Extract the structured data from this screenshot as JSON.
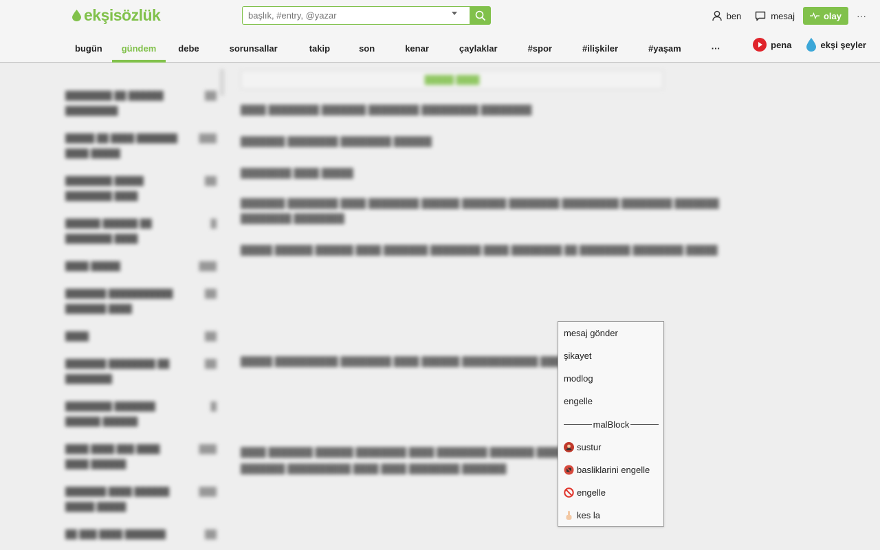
{
  "header": {
    "logo_text": "ekşisözlük",
    "search_placeholder": "başlık, #entry, @yazar",
    "user_label": "ben",
    "message_label": "mesaj",
    "olay_label": "olay",
    "more_label": "···"
  },
  "nav": {
    "tabs": [
      {
        "label": "bugün"
      },
      {
        "label": "gündem"
      },
      {
        "label": "debe"
      },
      {
        "label": "sorunsallar"
      },
      {
        "label": "takip"
      },
      {
        "label": "son"
      },
      {
        "label": "kenar"
      },
      {
        "label": "çaylaklar"
      },
      {
        "label": "#spor"
      },
      {
        "label": "#ilişkiler"
      },
      {
        "label": "#yaşam"
      },
      {
        "label": "···"
      }
    ],
    "active_tab": "gündem",
    "pena_label": "pena",
    "eksi_seyler_label": "ekşi şeyler"
  },
  "menu": {
    "items": [
      {
        "label": "mesaj gönder"
      },
      {
        "label": "şikayet"
      },
      {
        "label": "modlog"
      },
      {
        "label": "engelle"
      }
    ],
    "section_title": "malBlock",
    "extra_items": [
      {
        "label": "sustur",
        "icon": "mute-icon"
      },
      {
        "label": "basliklarini engelle",
        "icon": "block-titles-icon"
      },
      {
        "label": "engelle",
        "icon": "prohibited-icon"
      },
      {
        "label": "kes la",
        "icon": "finger-icon"
      }
    ]
  },
  "colors": {
    "accent": "#81c14b",
    "pena_red": "#e0242b",
    "eksi_seyler_blue": "#3ca7d8"
  }
}
